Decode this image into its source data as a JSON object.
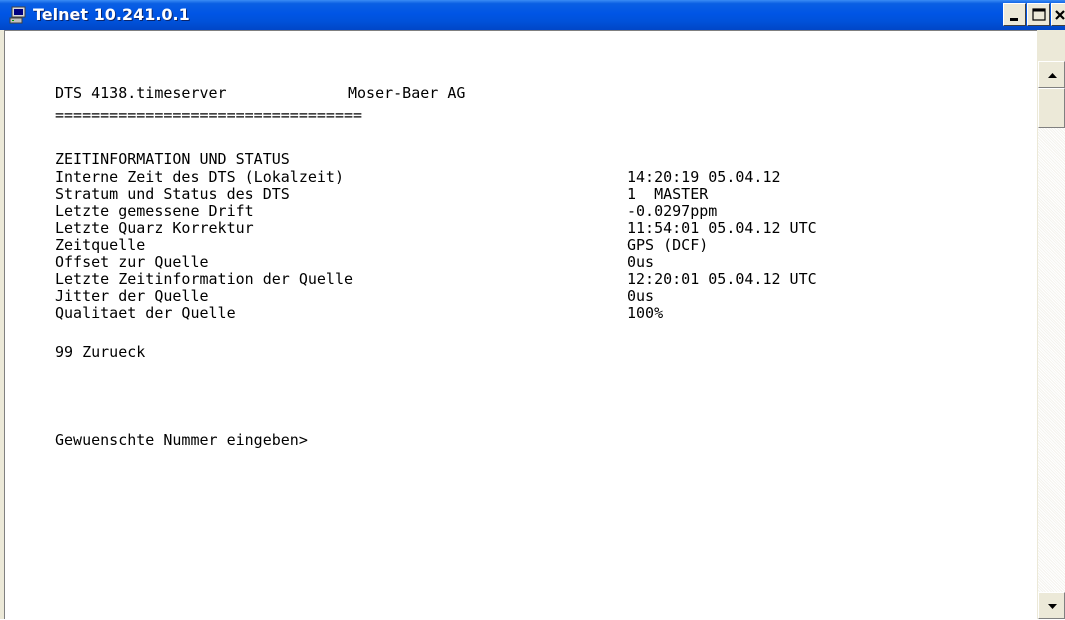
{
  "window": {
    "title": "Telnet 10.241.0.1"
  },
  "icons": {
    "app": "telnet-app-icon",
    "minimize": "minimize-icon",
    "maximize": "maximize-icon",
    "close": "close-icon",
    "scroll_up": "arrow-up-icon",
    "scroll_down": "arrow-down-icon"
  },
  "colors": {
    "titlebar": "#0055e5",
    "frame": "#ece9d8",
    "console_bg": "#ffffff",
    "console_text": "#000000"
  },
  "console": {
    "header_left": "DTS 4138.timeserver",
    "header_right": "Moser-Baer AG",
    "separator": "==================================",
    "section_title": "ZEITINFORMATION UND STATUS",
    "rows": [
      {
        "label": "Interne Zeit des DTS (Lokalzeit)",
        "value": "14:20:19 05.04.12"
      },
      {
        "label": "Stratum und Status des DTS",
        "value": "1  MASTER"
      },
      {
        "label": "Letzte gemessene Drift",
        "value": "-0.0297ppm"
      },
      {
        "label": "Letzte Quarz Korrektur",
        "value": "11:54:01 05.04.12 UTC"
      },
      {
        "label": "Zeitquelle",
        "value": "GPS (DCF)"
      },
      {
        "label": "Offset zur Quelle",
        "value": "0us"
      },
      {
        "label": "Letzte Zeitinformation der Quelle",
        "value": "12:20:01 05.04.12 UTC"
      },
      {
        "label": "Jitter der Quelle",
        "value": "0us"
      },
      {
        "label": "Qualitaet der Quelle",
        "value": "100%"
      }
    ],
    "menu_option": "99 Zurueck",
    "prompt": "Gewuenschte Nummer eingeben>"
  }
}
